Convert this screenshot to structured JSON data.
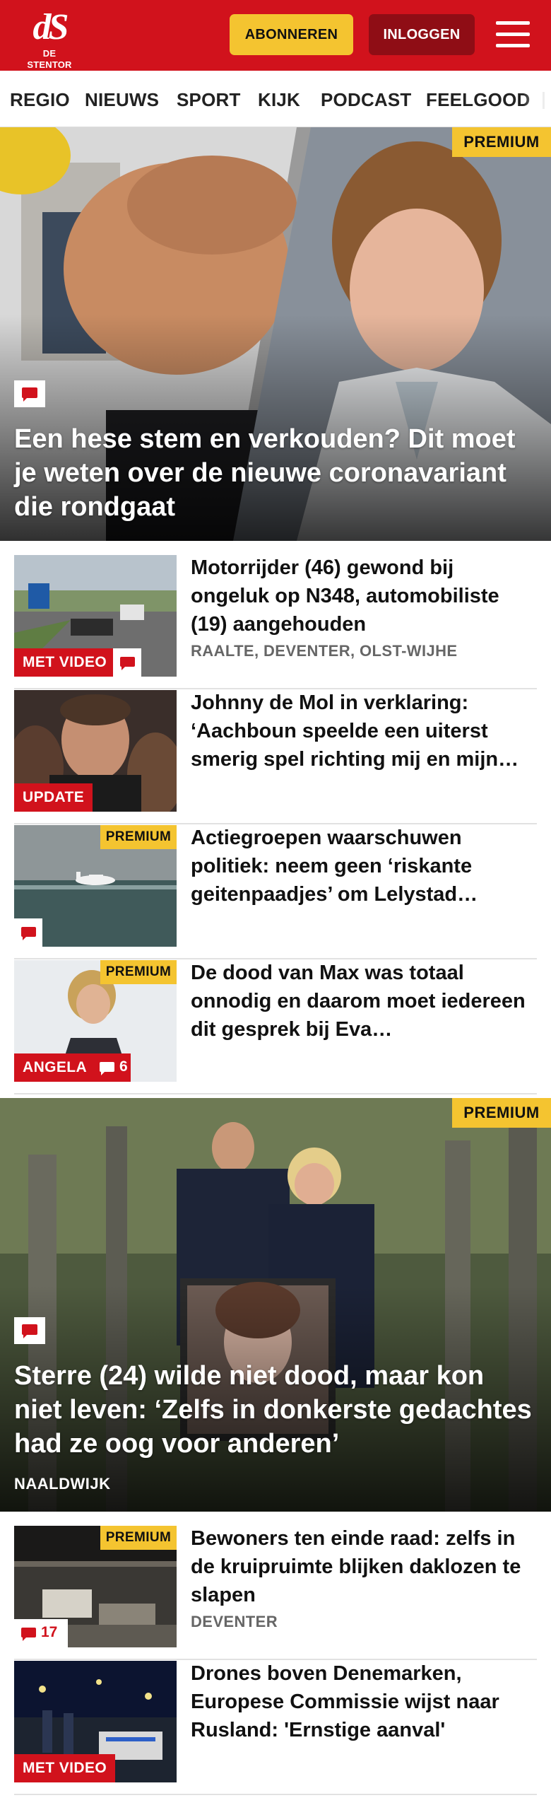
{
  "header": {
    "logo_mark": "dS",
    "logo_text": "DE STENTOR",
    "subscribe_label": "ABONNEREN",
    "login_label": "INLOGGEN",
    "menu_icon": "hamburger-menu-icon"
  },
  "nav": {
    "items": [
      "REGIO",
      "NIEUWS",
      "SPORT",
      "KIJK",
      "PODCAST",
      "FEELGOOD"
    ]
  },
  "colors": {
    "brand_red": "#d1121c",
    "dark_red": "#8f0d15",
    "premium_yellow": "#f4c430",
    "meta_gray": "#666666"
  },
  "articles": [
    {
      "title": "Een hese stem en verkouden? Dit moet je weten over de nieuwe coronavariant die rondgaat",
      "badge": "PREMIUM",
      "comment_icon": "comment-icon"
    },
    {
      "title": "Motorrijder (46) gewond bij ongeluk op N348, automobiliste (19) aangehouden",
      "location": "RAALTE, DEVENTER, OLST-WIJHE",
      "label": "MET VIDEO",
      "comment_icon": "comment-icon"
    },
    {
      "title": "Johnny de Mol in verklaring: ‘Aachboun speelde een uiterst smerig spel richting mij en mijn…",
      "label": "UPDATE"
    },
    {
      "title": "Actiegroepen waarschuwen politiek: neem geen ‘riskante geitenpaadjes’ om Lelystad…",
      "badge": "PREMIUM",
      "comment_icon": "comment-icon"
    },
    {
      "title": "De dood van Max was totaal onnodig en daarom moet iedereen dit gesprek bij Eva…",
      "badge": "PREMIUM",
      "label": "ANGELA",
      "comment_count": "6"
    },
    {
      "title": "Sterre (24) wilde niet dood, maar kon niet leven: ‘Zelfs in donkerste gedachtes had ze oog voor anderen’",
      "location": "NAALDWIJK",
      "badge": "PREMIUM",
      "comment_icon": "comment-icon"
    },
    {
      "title": "Bewoners ten einde raad: zelfs in de kruipruimte blijken daklozen te slapen",
      "location": "DEVENTER",
      "badge": "PREMIUM",
      "comment_count": "17"
    },
    {
      "title": "Drones boven Denemarken, Europese Commissie wijst naar Rusland: 'Ernstige aanval'",
      "label": "MET VIDEO"
    }
  ]
}
